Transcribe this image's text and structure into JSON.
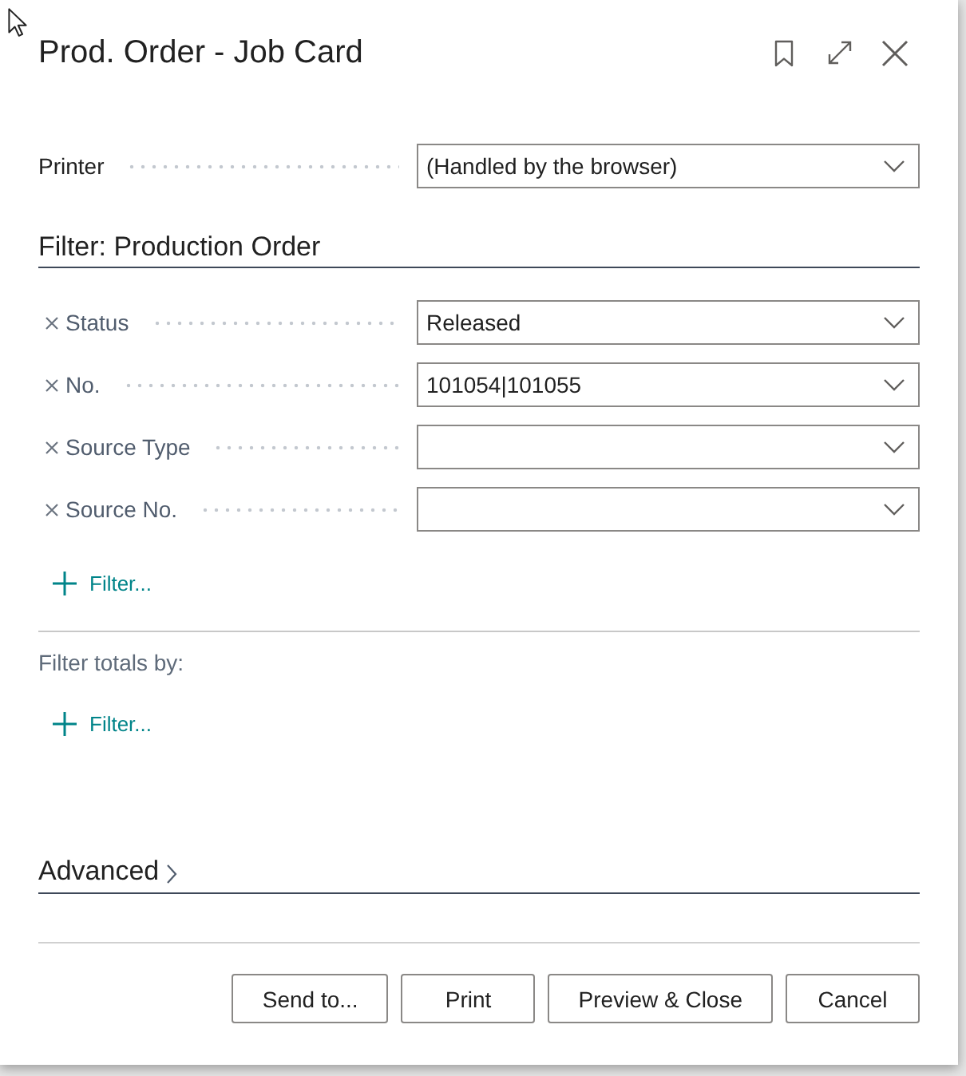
{
  "window": {
    "title": "Prod. Order - Job Card"
  },
  "printer": {
    "label": "Printer",
    "value": "(Handled by the browser)"
  },
  "filter_section": {
    "title": "Filter: Production Order",
    "filters": [
      {
        "label": "Status",
        "value": "Released"
      },
      {
        "label": "No.",
        "value": "101054|101055"
      },
      {
        "label": "Source Type"
      },
      {
        "label": "Source No."
      }
    ],
    "add_filter": "Filter..."
  },
  "totals_section": {
    "title": "Filter totals by:",
    "add_filter": "Filter..."
  },
  "advanced": {
    "title": "Advanced",
    "expanded": false
  },
  "buttons": [
    "Send to...",
    "Print",
    "Preview & Close",
    "Cancel"
  ]
}
